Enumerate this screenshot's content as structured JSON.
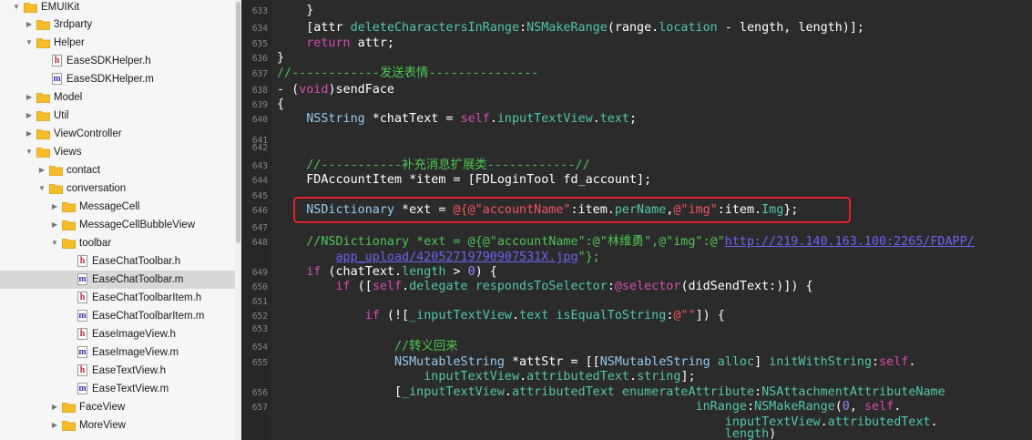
{
  "colors": {
    "navigator_bg": "#f6f6f6",
    "editor_bg": "#2b2b2b",
    "folder": "#f6bd2a",
    "highlight_box": "#e5222b",
    "keyword": "#d64bb2",
    "comment": "#4cc552",
    "string": "#f2525f"
  },
  "navigator": {
    "items": [
      {
        "label": "EMUIKit",
        "kind": "folder",
        "expanded": true
      },
      {
        "label": "3rdparty",
        "kind": "folder",
        "expanded": false
      },
      {
        "label": "Helper",
        "kind": "folder",
        "expanded": true
      },
      {
        "label": "EaseSDKHelper.h",
        "kind": "file",
        "ext": "h",
        "icon": "h"
      },
      {
        "label": "EaseSDKHelper.m",
        "kind": "file",
        "ext": "m",
        "icon": "m"
      },
      {
        "label": "Model",
        "kind": "folder",
        "expanded": false
      },
      {
        "label": "Util",
        "kind": "folder",
        "expanded": false
      },
      {
        "label": "ViewController",
        "kind": "folder",
        "expanded": false
      },
      {
        "label": "Views",
        "kind": "folder",
        "expanded": true
      },
      {
        "label": "contact",
        "kind": "folder",
        "expanded": false
      },
      {
        "label": "conversation",
        "kind": "folder",
        "expanded": true
      },
      {
        "label": "MessageCell",
        "kind": "folder",
        "expanded": false
      },
      {
        "label": "MessageCellBubbleView",
        "kind": "folder",
        "expanded": false
      },
      {
        "label": "toolbar",
        "kind": "folder",
        "expanded": true
      },
      {
        "label": "EaseChatToolbar.h",
        "kind": "file",
        "ext": "h",
        "icon": "h"
      },
      {
        "label": "EaseChatToolbar.m",
        "kind": "file",
        "ext": "m",
        "icon": "m",
        "selected": true
      },
      {
        "label": "EaseChatToolbarItem.h",
        "kind": "file",
        "ext": "h",
        "icon": "h"
      },
      {
        "label": "EaseChatToolbarItem.m",
        "kind": "file",
        "ext": "m",
        "icon": "m"
      },
      {
        "label": "EaseImageView.h",
        "kind": "file",
        "ext": "h",
        "icon": "h"
      },
      {
        "label": "EaseImageView.m",
        "kind": "file",
        "ext": "m",
        "icon": "m"
      },
      {
        "label": "EaseTextView.h",
        "kind": "file",
        "ext": "h",
        "icon": "h"
      },
      {
        "label": "EaseTextView.m",
        "kind": "file",
        "ext": "m",
        "icon": "m"
      },
      {
        "label": "FaceView",
        "kind": "folder",
        "expanded": false
      },
      {
        "label": "MoreView",
        "kind": "folder",
        "expanded": false
      }
    ]
  },
  "editor": {
    "lines": [
      {
        "number": "633",
        "segments": [
          {
            "t": "    }",
            "c": ""
          }
        ]
      },
      {
        "number": "634",
        "segments": [
          {
            "t": "    [attr ",
            "c": ""
          },
          {
            "t": "deleteCharactersInRange",
            "c": "fn"
          },
          {
            "t": ":",
            "c": ""
          },
          {
            "t": "NSMakeRange",
            "c": "fn"
          },
          {
            "t": "(range.",
            "c": ""
          },
          {
            "t": "location",
            "c": "fn"
          },
          {
            "t": " - length, length)];",
            "c": ""
          }
        ]
      },
      {
        "number": "635",
        "segments": [
          {
            "t": "    ",
            "c": ""
          },
          {
            "t": "return",
            "c": "kw"
          },
          {
            "t": " attr;",
            "c": ""
          }
        ]
      },
      {
        "number": "636",
        "segments": [
          {
            "t": "}",
            "c": ""
          }
        ]
      },
      {
        "number": "637",
        "segments": [
          {
            "t": "//------------发送表情---------------",
            "c": "cm"
          }
        ]
      },
      {
        "number": "638",
        "segments": [
          {
            "t": "- (",
            "c": ""
          },
          {
            "t": "void",
            "c": "kw"
          },
          {
            "t": ")sendFace",
            "c": ""
          }
        ]
      },
      {
        "number": "639",
        "segments": [
          {
            "t": "{",
            "c": ""
          }
        ]
      },
      {
        "number": "640",
        "segments": [
          {
            "t": "    ",
            "c": ""
          },
          {
            "t": "NSString",
            "c": "ty"
          },
          {
            "t": " *chatText = ",
            "c": ""
          },
          {
            "t": "self",
            "c": "kw"
          },
          {
            "t": ".",
            "c": ""
          },
          {
            "t": "inputTextView",
            "c": "fn"
          },
          {
            "t": ".",
            "c": ""
          },
          {
            "t": "text",
            "c": "fn"
          },
          {
            "t": ";",
            "c": ""
          }
        ]
      },
      {
        "number": "641",
        "segments": []
      },
      {
        "number": "642",
        "segments": []
      },
      {
        "number": "643",
        "segments": [
          {
            "t": "    //-----------补充消息扩展类------------//",
            "c": "cm"
          }
        ]
      },
      {
        "number": "644",
        "segments": [
          {
            "t": "    FDAccountItem *item = [FDLoginTool fd_account];",
            "c": ""
          }
        ]
      },
      {
        "number": "645",
        "segments": []
      },
      {
        "number": "646",
        "segments": [
          {
            "t": "    ",
            "c": ""
          },
          {
            "t": "NSDictionary",
            "c": "ty"
          },
          {
            "t": " *ext = ",
            "c": ""
          },
          {
            "t": "@{@\"accountName\"",
            "c": "st"
          },
          {
            "t": ":item.",
            "c": ""
          },
          {
            "t": "perName",
            "c": "fn"
          },
          {
            "t": ",",
            "c": ""
          },
          {
            "t": "@\"img\"",
            "c": "st"
          },
          {
            "t": ":item.",
            "c": ""
          },
          {
            "t": "Img",
            "c": "fn"
          },
          {
            "t": "};",
            "c": ""
          }
        ]
      },
      {
        "number": "647",
        "segments": []
      },
      {
        "number": "648",
        "segments": [
          {
            "t": "    //NSDictionary *ext = @{@\"accountName\":@\"林维勇\",@\"img\":@\"",
            "c": "cm"
          },
          {
            "t": "http://219.140.163.100:2265/FDAPP/",
            "c": "ur"
          }
        ]
      },
      {
        "number": "",
        "segments": [
          {
            "t": "        ",
            "c": ""
          },
          {
            "t": "app_upload/42052719790907531X.jpg",
            "c": "ur"
          },
          {
            "t": "\"};",
            "c": "cm"
          }
        ]
      },
      {
        "number": "649",
        "segments": [
          {
            "t": "    ",
            "c": ""
          },
          {
            "t": "if",
            "c": "kw"
          },
          {
            "t": " (chatText.",
            "c": ""
          },
          {
            "t": "length",
            "c": "fn"
          },
          {
            "t": " > ",
            "c": ""
          },
          {
            "t": "0",
            "c": "nu"
          },
          {
            "t": ") {",
            "c": ""
          }
        ]
      },
      {
        "number": "650",
        "segments": [
          {
            "t": "        ",
            "c": ""
          },
          {
            "t": "if",
            "c": "kw"
          },
          {
            "t": " ([",
            "c": ""
          },
          {
            "t": "self",
            "c": "kw"
          },
          {
            "t": ".",
            "c": ""
          },
          {
            "t": "delegate",
            "c": "fn"
          },
          {
            "t": " ",
            "c": ""
          },
          {
            "t": "respondsToSelector",
            "c": "fn"
          },
          {
            "t": ":",
            "c": ""
          },
          {
            "t": "@selector",
            "c": "kw"
          },
          {
            "t": "(didSendText:)]) {",
            "c": ""
          }
        ]
      },
      {
        "number": "651",
        "segments": []
      },
      {
        "number": "652",
        "segments": [
          {
            "t": "            ",
            "c": ""
          },
          {
            "t": "if",
            "c": "kw"
          },
          {
            "t": " (![",
            "c": ""
          },
          {
            "t": "_inputTextView",
            "c": "fn"
          },
          {
            "t": ".",
            "c": ""
          },
          {
            "t": "text",
            "c": "fn"
          },
          {
            "t": " ",
            "c": ""
          },
          {
            "t": "isEqualToString",
            "c": "fn"
          },
          {
            "t": ":",
            "c": ""
          },
          {
            "t": "@\"\"",
            "c": "st"
          },
          {
            "t": "]) {",
            "c": ""
          }
        ]
      },
      {
        "number": "653",
        "segments": []
      },
      {
        "number": "654",
        "segments": [
          {
            "t": "                //转义回来",
            "c": "cm"
          }
        ]
      },
      {
        "number": "655",
        "segments": [
          {
            "t": "                ",
            "c": ""
          },
          {
            "t": "NSMutableString",
            "c": "ty"
          },
          {
            "t": " *attStr = [[",
            "c": ""
          },
          {
            "t": "NSMutableString",
            "c": "ty"
          },
          {
            "t": " ",
            "c": ""
          },
          {
            "t": "alloc",
            "c": "fn"
          },
          {
            "t": "] ",
            "c": ""
          },
          {
            "t": "initWithString",
            "c": "fn"
          },
          {
            "t": ":",
            "c": ""
          },
          {
            "t": "self",
            "c": "kw"
          },
          {
            "t": ".",
            "c": ""
          }
        ]
      },
      {
        "number": "",
        "segments": [
          {
            "t": "                    ",
            "c": ""
          },
          {
            "t": "inputTextView",
            "c": "fn"
          },
          {
            "t": ".",
            "c": ""
          },
          {
            "t": "attributedText",
            "c": "fn"
          },
          {
            "t": ".",
            "c": ""
          },
          {
            "t": "string",
            "c": "fn"
          },
          {
            "t": "];",
            "c": ""
          }
        ]
      },
      {
        "number": "656",
        "segments": [
          {
            "t": "                [",
            "c": ""
          },
          {
            "t": "_inputTextView",
            "c": "fn"
          },
          {
            "t": ".",
            "c": ""
          },
          {
            "t": "attributedText",
            "c": "fn"
          },
          {
            "t": " ",
            "c": ""
          },
          {
            "t": "enumerateAttribute",
            "c": "fn"
          },
          {
            "t": ":",
            "c": ""
          },
          {
            "t": "NSAttachmentAttributeName",
            "c": "fn"
          }
        ]
      },
      {
        "number": "657",
        "segments": [
          {
            "t": "                                                         ",
            "c": ""
          },
          {
            "t": "inRange",
            "c": "fn"
          },
          {
            "t": ":",
            "c": ""
          },
          {
            "t": "NSMakeRange",
            "c": "fn"
          },
          {
            "t": "(",
            "c": ""
          },
          {
            "t": "0",
            "c": "nu"
          },
          {
            "t": ", ",
            "c": ""
          },
          {
            "t": "self",
            "c": "kw"
          },
          {
            "t": ".",
            "c": ""
          }
        ]
      },
      {
        "number": "",
        "segments": [
          {
            "t": "                                                             ",
            "c": ""
          },
          {
            "t": "inputTextView",
            "c": "fn"
          },
          {
            "t": ".",
            "c": ""
          },
          {
            "t": "attributedText",
            "c": "fn"
          },
          {
            "t": ".",
            "c": ""
          }
        ]
      },
      {
        "number": "",
        "segments": [
          {
            "t": "                                                             ",
            "c": ""
          },
          {
            "t": "length",
            "c": "fn"
          },
          {
            "t": ")",
            "c": ""
          }
        ]
      }
    ]
  }
}
